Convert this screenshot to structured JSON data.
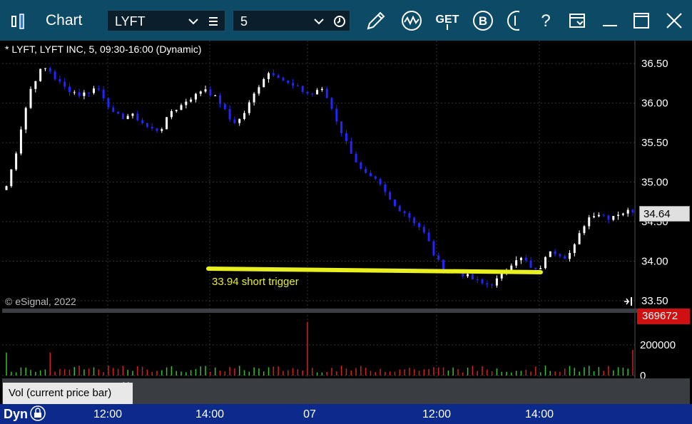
{
  "toolbar": {
    "title": "Chart",
    "symbol": "LYFT",
    "interval": "5",
    "icons": [
      "chart-icon",
      "list-icon",
      "clock-icon",
      "pencil-icon",
      "wave-icon",
      "get-icon",
      "b-icon",
      "partial-icon",
      "help-icon",
      "layout-icon",
      "minimize-icon",
      "maximize-icon",
      "close-icon"
    ],
    "get_label": "GET",
    "b_label": "B",
    "help_label": "?"
  },
  "chart": {
    "header": "* LYFT, LYFT INC, 5, 09:30-16:00 (Dynamic)",
    "watermark": "© eSignal, 2022",
    "last_price": "34.64",
    "last_volume": "369672",
    "price_ticks": [
      "36.50",
      "36.00",
      "35.50",
      "35.00",
      "34.50",
      "34.00",
      "33.50"
    ],
    "volume_ticks": [
      "200000",
      "0"
    ],
    "time_ticks": [
      "12:00",
      "14:00",
      "07",
      "12:00",
      "14:00"
    ],
    "annotation": "33.94 short trigger",
    "colors": {
      "up": "#ffffff",
      "down": "#2424ff",
      "trendline": "#e8f020",
      "annotation": "#e8f020",
      "vol_up": "#30c030",
      "vol_down": "#d02020"
    }
  },
  "chart_data": {
    "type": "candlestick",
    "title": "* LYFT, LYFT INC, 5, 09:30-16:00 (Dynamic)",
    "ylim": [
      33.4,
      36.7
    ],
    "x_ticks": [
      "12:00",
      "14:00",
      "07",
      "12:00",
      "14:00"
    ],
    "y_ticks": [
      36.5,
      36.0,
      35.5,
      35.0,
      34.5,
      34.0,
      33.5
    ],
    "close_path": [
      34.95,
      35.3,
      35.8,
      36.2,
      36.4,
      36.45,
      36.3,
      36.2,
      36.15,
      36.1,
      36.15,
      36.2,
      36.05,
      35.85,
      35.82,
      35.85,
      35.8,
      35.7,
      35.65,
      35.7,
      35.9,
      35.95,
      36.05,
      36.1,
      36.2,
      36.1,
      36.0,
      35.8,
      35.75,
      35.9,
      36.1,
      36.3,
      36.4,
      36.35,
      36.25,
      36.2,
      36.15,
      36.1,
      36.2,
      36.05,
      35.8,
      35.55,
      35.35,
      35.15,
      35.05,
      35.0,
      34.85,
      34.7,
      34.65,
      34.55,
      34.45,
      34.3,
      34.05,
      33.9,
      33.88,
      33.86,
      33.8,
      33.75,
      33.7,
      33.72,
      33.8,
      33.95,
      34.05,
      34.0,
      33.85,
      33.95,
      34.15,
      34.1,
      34.05,
      34.2,
      34.45,
      34.6,
      34.6,
      34.55,
      34.6,
      34.62,
      34.64
    ],
    "volume_ylim": [
      0,
      400000
    ],
    "volume_last": 369672,
    "trendline": {
      "y": 33.94,
      "label": "33.94 short trigger"
    }
  }
}
